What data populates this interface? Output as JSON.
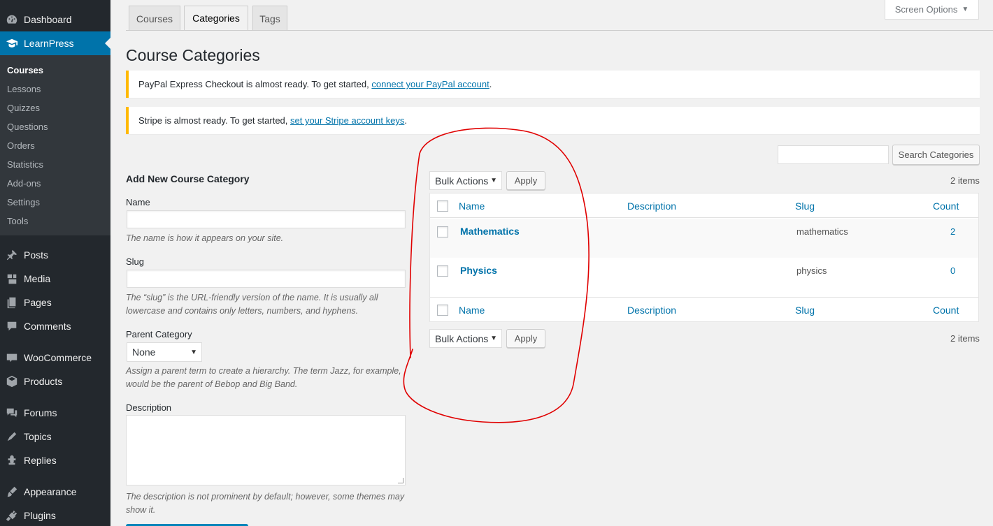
{
  "sidebar": {
    "items": [
      {
        "label": "Dashboard",
        "icon": "dashboard-icon"
      },
      {
        "label": "LearnPress",
        "icon": "graduation-cap-icon",
        "current": true
      },
      {
        "label": "Posts",
        "icon": "pin-icon"
      },
      {
        "label": "Media",
        "icon": "media-icon"
      },
      {
        "label": "Pages",
        "icon": "pages-icon"
      },
      {
        "label": "Comments",
        "icon": "comment-icon"
      },
      {
        "label": "WooCommerce",
        "icon": "woo-icon"
      },
      {
        "label": "Products",
        "icon": "box-icon"
      },
      {
        "label": "Forums",
        "icon": "forums-icon"
      },
      {
        "label": "Topics",
        "icon": "topics-icon"
      },
      {
        "label": "Replies",
        "icon": "replies-icon"
      },
      {
        "label": "Appearance",
        "icon": "brush-icon"
      },
      {
        "label": "Plugins",
        "icon": "plugin-icon"
      }
    ],
    "submenu": [
      "Courses",
      "Lessons",
      "Quizzes",
      "Questions",
      "Orders",
      "Statistics",
      "Add-ons",
      "Settings",
      "Tools"
    ]
  },
  "tabs": [
    "Courses",
    "Categories",
    "Tags"
  ],
  "screen_options": "Screen Options",
  "page_title": "Course Categories",
  "notices": {
    "paypal": {
      "text": "PayPal Express Checkout is almost ready. To get started, ",
      "link": "connect your PayPal account",
      "end": "."
    },
    "stripe": {
      "text": "Stripe is almost ready. To get started, ",
      "link": "set your Stripe account keys",
      "end": "."
    }
  },
  "form": {
    "heading": "Add New Course Category",
    "name_label": "Name",
    "name_help": "The name is how it appears on your site.",
    "slug_label": "Slug",
    "slug_help": "The “slug” is the URL-friendly version of the name. It is usually all lowercase and contains only letters, numbers, and hyphens.",
    "parent_label": "Parent Category",
    "parent_value": "None",
    "parent_help": "Assign a parent term to create a hierarchy. The term Jazz, for example, would be the parent of Bebop and Big Band.",
    "description_label": "Description",
    "description_help": "The description is not prominent by default; however, some themes may show it."
  },
  "list": {
    "search_button": "Search Categories",
    "bulk_actions": "Bulk Actions",
    "apply": "Apply",
    "items_count": "2 items",
    "columns": [
      "Name",
      "Description",
      "Slug",
      "Count"
    ],
    "rows": [
      {
        "name": "Mathematics",
        "slug": "mathematics",
        "count": "2"
      },
      {
        "name": "Physics",
        "slug": "physics",
        "count": "0"
      }
    ]
  },
  "colors": {
    "sidebar": "#23282d",
    "accent": "#0073aa",
    "notice": "#ffb900",
    "annotation": "#e00000"
  }
}
